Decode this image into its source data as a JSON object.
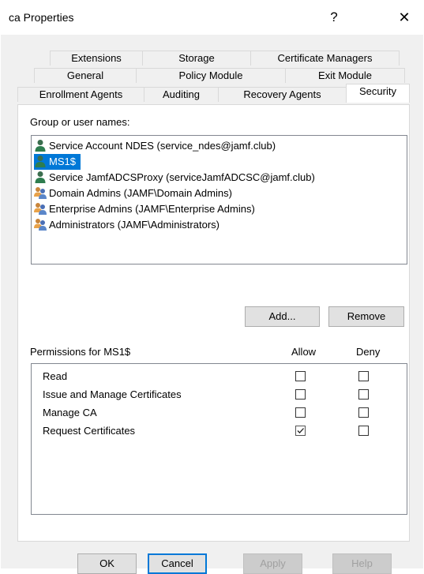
{
  "window": {
    "title": "ca Properties",
    "help_glyph": "?",
    "close_glyph": "✕"
  },
  "tabs": {
    "row1": [
      "Extensions",
      "Storage",
      "Certificate Managers"
    ],
    "row2": [
      "General",
      "Policy Module",
      "Exit Module"
    ],
    "row3": [
      "Enrollment Agents",
      "Auditing",
      "Recovery Agents",
      "Security"
    ],
    "active": "Security"
  },
  "security": {
    "group_label": "Group or user names:",
    "principals": [
      {
        "name": "Service Account NDES (service_ndes@jamf.club)",
        "icon": "user-icon",
        "selected": false
      },
      {
        "name": "MS1$",
        "icon": "user-icon",
        "selected": true
      },
      {
        "name": "Service JamfADCSProxy (serviceJamfADCSC@jamf.club)",
        "icon": "user-icon",
        "selected": false
      },
      {
        "name": "Domain Admins (JAMF\\Domain Admins)",
        "icon": "group-icon",
        "selected": false
      },
      {
        "name": "Enterprise Admins (JAMF\\Enterprise Admins)",
        "icon": "group-icon",
        "selected": false
      },
      {
        "name": "Administrators (JAMF\\Administrators)",
        "icon": "group-icon",
        "selected": false
      }
    ],
    "add_label": "Add...",
    "remove_label": "Remove",
    "permissions_label": "Permissions for MS1$",
    "allow_label": "Allow",
    "deny_label": "Deny",
    "permissions": [
      {
        "name": "Read",
        "allow": false,
        "deny": false
      },
      {
        "name": "Issue and Manage Certificates",
        "allow": false,
        "deny": false
      },
      {
        "name": "Manage CA",
        "allow": false,
        "deny": false
      },
      {
        "name": "Request Certificates",
        "allow": true,
        "deny": false
      }
    ]
  },
  "footer": {
    "ok": "OK",
    "cancel": "Cancel",
    "apply": "Apply",
    "help": "Help"
  },
  "colors": {
    "selection": "#0078d7",
    "user_icon": "#2e7d4f",
    "group_icon": "#e8a24a"
  }
}
